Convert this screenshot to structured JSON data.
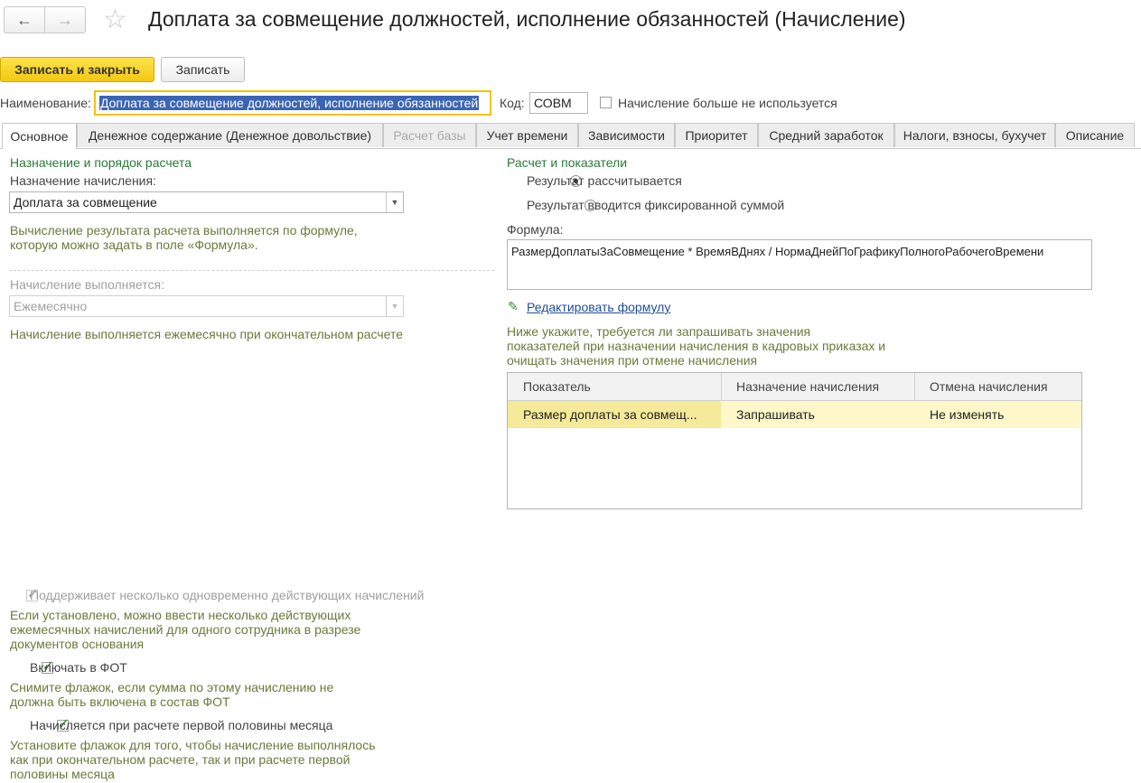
{
  "window": {
    "title": "Доплата за совмещение должностей, исполнение обязанностей (Начисление)",
    "nav_back": "←",
    "nav_forward": "→",
    "favorite": "☆"
  },
  "toolbar": {
    "save_close_label": "Записать и закрыть",
    "save_label": "Записать"
  },
  "header": {
    "name_label": "Наименование:",
    "name_value": "Доплата за совмещение должностей, исполнение обязанностей",
    "code_label": "Код:",
    "code_value": "СОВМ",
    "unused_label": "Начисление больше не используется",
    "unused_checked": false
  },
  "tabs": [
    {
      "label": "Основное",
      "active": true
    },
    {
      "label": "Денежное содержание (Денежное довольствие)"
    },
    {
      "label": "Расчет базы",
      "disabled": true
    },
    {
      "label": "Учет времени"
    },
    {
      "label": "Зависимости"
    },
    {
      "label": "Приоритет"
    },
    {
      "label": "Средний заработок"
    },
    {
      "label": "Налоги, взносы, бухучет"
    },
    {
      "label": "Описание"
    }
  ],
  "left": {
    "section_title": "Назначение и порядок расчета",
    "purpose_label": "Назначение начисления:",
    "purpose_value": "Доплата за совмещение",
    "purpose_note_1": "Вычисление результата расчета выполняется по формуле,",
    "purpose_note_2": "которую можно задать в поле «Формула».",
    "period_label": "Начисление выполняется:",
    "period_value": "Ежемесячно",
    "period_note": "Начисление выполняется ежемесячно при окончательном расчете",
    "multi_label": "Поддерживает несколько одновременно действующих начислений",
    "multi_note_1": "Если установлено, можно ввести несколько действующих",
    "multi_note_2": "ежемесячных начислений для одного сотрудника в разрезе",
    "multi_note_3": "документов основания",
    "fot_label": "Включать в ФОТ",
    "fot_note_1": "Снимите флажок, если сумма по этому начислению не",
    "fot_note_2": "должна быть включена в состав ФОТ",
    "half_label": "Начисляется при расчете первой половины месяца",
    "half_note_1": "Установите флажок для того, чтобы начисление выполнялось",
    "half_note_2": "как при окончательном расчете, так и при расчете первой",
    "half_note_3": "половины месяца"
  },
  "right": {
    "section_title": "Расчет и показатели",
    "radio_calc": "Результат рассчитывается",
    "radio_fixed": "Результат вводится фиксированной суммой",
    "formula_label": "Формула:",
    "formula_value": "РазмерДоплатыЗаСовмещение * ВремяВДнях / НормаДнейПоГрафикуПолногоРабочегоВремени",
    "edit_formula": "Редактировать формулу",
    "indicators_note_1": "Ниже укажите, требуется ли запрашивать значения",
    "indicators_note_2": "показателей при назначении начисления в кадровых приказах и",
    "indicators_note_3": "очищать значения при отмене начисления",
    "table": {
      "columns": [
        "Показатель",
        "Назначение начисления",
        "Отмена начисления"
      ],
      "rows": [
        [
          "Размер доплаты за совмещ...",
          "Запрашивать",
          "Не изменять"
        ]
      ]
    }
  }
}
